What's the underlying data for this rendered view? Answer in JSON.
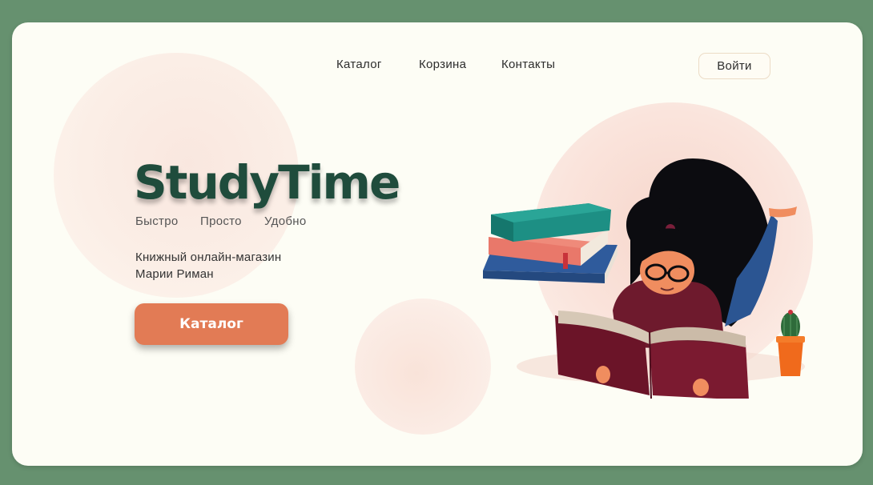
{
  "nav": {
    "catalog": "Каталог",
    "cart": "Корзина",
    "contacts": "Контакты",
    "login": "Войти"
  },
  "hero": {
    "title": "StudyTime",
    "taglines": [
      "Быстро",
      "Просто",
      "Удобно"
    ],
    "description_line1": "Книжный онлайн-магазин",
    "description_line2": "Марии Риман",
    "cta": "Каталог"
  },
  "colors": {
    "frame_background": "#66916f",
    "card_background": "#fdfdf5",
    "title": "#1f4c3c",
    "cta": "#e27b55"
  },
  "icons": [
    "reading-girl-illustration",
    "book-stack-icon",
    "cactus-icon"
  ]
}
